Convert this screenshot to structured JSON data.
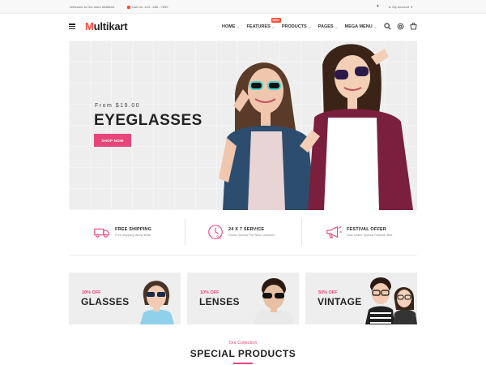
{
  "topbar": {
    "welcome": "Welcome to Our store Multikart",
    "phone": "Call Us: 123 - 456 - 7890",
    "account": "My Account"
  },
  "header": {
    "logo_first": "M",
    "logo_rest": "ultikart",
    "nav": [
      {
        "label": "HOME"
      },
      {
        "label": "FEATURES",
        "badge": "NEW"
      },
      {
        "label": "PRODUCTS"
      },
      {
        "label": "PAGES"
      },
      {
        "label": "MEGA MENU"
      }
    ],
    "icons": [
      "search-icon",
      "settings-icon",
      "cart-icon"
    ]
  },
  "hero": {
    "from": "From $19.00",
    "title": "EYEGLASSES",
    "button": "SHOP NOW"
  },
  "services": [
    {
      "title": "FREE SHIPPING",
      "subtitle": "Free Shipping World Wide",
      "icon": "truck-icon"
    },
    {
      "title": "24 X 7 SERVICE",
      "subtitle": "Online Service For New Customer",
      "icon": "clock-24-icon"
    },
    {
      "title": "FESTIVAL OFFER",
      "subtitle": "New Online Special Festival Offer",
      "icon": "megaphone-icon"
    }
  ],
  "banners": [
    {
      "off": "10% OFF",
      "name": "GLASSES"
    },
    {
      "off": "10% OFF",
      "name": "LENSES"
    },
    {
      "off": "50% OFF",
      "name": "VINTAGE"
    }
  ],
  "collection": {
    "subtitle": "Our Collection",
    "title": "SPECIAL PRODUCTS"
  },
  "colors": {
    "accent": "#e8457a",
    "hero_bg": "#eeeeee",
    "text": "#222222"
  }
}
